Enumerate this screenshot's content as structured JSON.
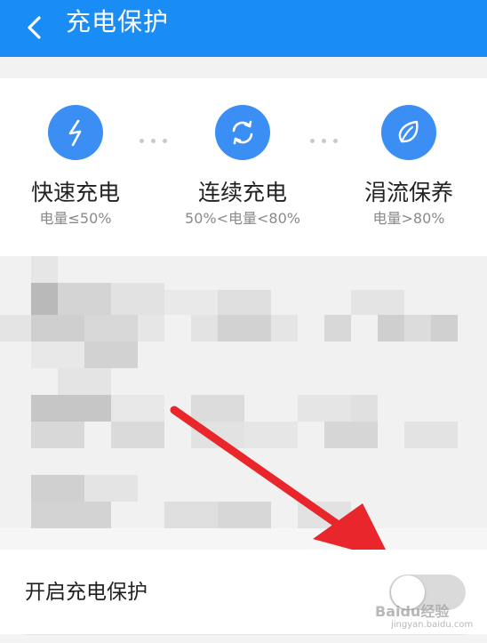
{
  "header": {
    "title": "充电保护",
    "back_icon": "back-arrow-icon",
    "bg_color": "#1a8cf5"
  },
  "modes": [
    {
      "name": "快速充电",
      "condition": "电量≤50%",
      "icon": "lightning-icon"
    },
    {
      "name": "连续充电",
      "condition": "50%<电量<80%",
      "icon": "refresh-icon"
    },
    {
      "name": "涓流保养",
      "condition": "电量>80%",
      "icon": "leaf-icon"
    }
  ],
  "setting": {
    "label": "开启充电保护",
    "enabled": false
  },
  "watermark": {
    "brand": "Baidu经验",
    "url": "jingyan.baidu.com"
  },
  "colors": {
    "accent": "#3a8ef4",
    "arrow": "#e8262b"
  }
}
